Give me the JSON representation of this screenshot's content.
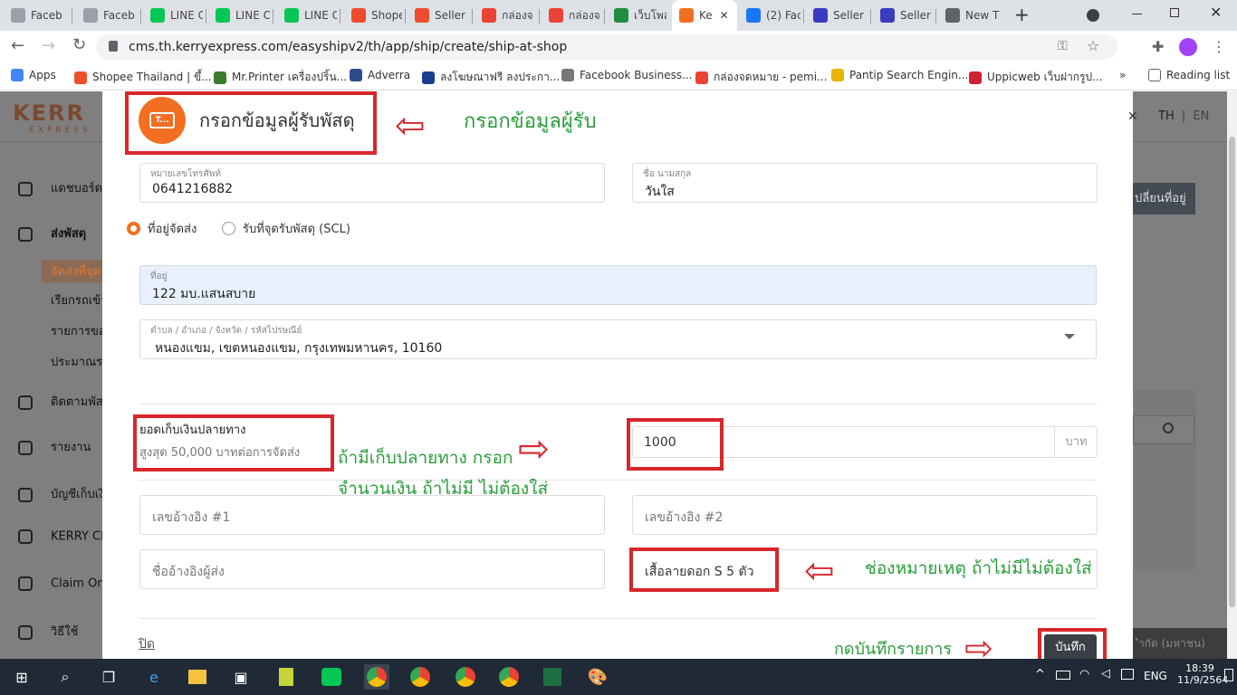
{
  "browser": {
    "tabs": [
      {
        "label": "Faceb",
        "icon": "facebook-icon",
        "color": "#9aa0a6"
      },
      {
        "label": "Faceb",
        "icon": "facebook-icon",
        "color": "#9aa0a6"
      },
      {
        "label": "LINE C",
        "icon": "line-icon",
        "color": "#06c755"
      },
      {
        "label": "LINE C",
        "icon": "line-icon",
        "color": "#06c755"
      },
      {
        "label": "LINE C",
        "icon": "line-icon",
        "color": "#06c755"
      },
      {
        "label": "Shope",
        "icon": "shopee-icon",
        "color": "#ee4d2d"
      },
      {
        "label": "Seller",
        "icon": "shopee-icon",
        "color": "#ee4d2d"
      },
      {
        "label": "กล่องจ",
        "icon": "gmail-icon",
        "color": "#ea4335"
      },
      {
        "label": "กล่องจ",
        "icon": "gmail-icon",
        "color": "#ea4335"
      },
      {
        "label": "เว็บโพส",
        "icon": "sheets-icon",
        "color": "#1e8e3e"
      },
      {
        "label": "Ke",
        "icon": "kerry-icon",
        "color": "#f26f21"
      },
      {
        "label": "(2) Fac",
        "icon": "facebook-icon",
        "color": "#1877f2"
      },
      {
        "label": "Seller",
        "icon": "seller-icon",
        "color": "#3b3bbf"
      },
      {
        "label": "Seller",
        "icon": "seller-icon",
        "color": "#3b3bbf"
      },
      {
        "label": "New T",
        "icon": "chrome-icon",
        "color": "#5f6368"
      }
    ],
    "url": "cms.th.kerryexpress.com/easyshipv2/th/app/ship/create/ship-at-shop",
    "bookmarks": [
      {
        "label": "Apps",
        "color": "#4285f4"
      },
      {
        "label": "Shopee Thailand | ขึ้...",
        "color": "#ee4d2d"
      },
      {
        "label": "Mr.Printer เครื่องปริ้น...",
        "color": "#3a7d2a"
      },
      {
        "label": "Adverra",
        "color": "#2b4c8c"
      },
      {
        "label": "ลงโฆษณาฟรี ลงประกา...",
        "color": "#1a3d8f"
      },
      {
        "label": "Facebook Business...",
        "color": "#777"
      },
      {
        "label": "กล่องจดหมาย - pemi...",
        "color": "#ea4335"
      },
      {
        "label": "Pantip Search Engin...",
        "color": "#e8b500"
      },
      {
        "label": "Uppicweb เว็บฝากรูป...",
        "color": "#cc2233"
      }
    ],
    "reading_list": "Reading list",
    "more": "»"
  },
  "background": {
    "logo_top": "KERR",
    "logo_bottom": "EXPRESS",
    "lang_th": "TH",
    "lang_sep": "|",
    "lang_en": "EN",
    "change_address_btn": "ปลี่ยนที่อยู่",
    "right_note": "ำกัด (มหาชน)",
    "sidebar": [
      {
        "label": "แดชบอร์ด",
        "icon": "dashboard-icon"
      },
      {
        "label": "ส่งพัสดุ",
        "icon": "ship-icon"
      },
      {
        "label": "จัดส่งที่จุด",
        "icon": ""
      },
      {
        "label": "เรียกรถเข้า",
        "icon": ""
      },
      {
        "label": "รายการขอ",
        "icon": ""
      },
      {
        "label": "ประมาณรา",
        "icon": ""
      },
      {
        "label": "ติดตามพัส",
        "icon": "track-icon"
      },
      {
        "label": "รายงาน",
        "icon": "report-icon"
      },
      {
        "label": "บัญชีเก็บเงิ",
        "icon": "account-icon"
      },
      {
        "label": "KERRY CL",
        "icon": "club-icon"
      },
      {
        "label": "Claim Onl",
        "icon": "claim-icon"
      },
      {
        "label": "วิธีใช้",
        "icon": "help-icon"
      }
    ]
  },
  "modal": {
    "header_icon_text": "T...",
    "title": "กรอกข้อมูลผู้รับพัสดุ",
    "phone": {
      "label": "หมายเลขโทรศัพท์",
      "value": "0641216882"
    },
    "name": {
      "label": "ชื่อ นามสกุล",
      "value": "วันใส"
    },
    "delivery_options": [
      {
        "label": "ที่อยู่จัดส่ง",
        "selected": true
      },
      {
        "label": "รับที่จุดรับพัสดุ (SCL)",
        "selected": false
      }
    ],
    "address": {
      "label": "ที่อยู่",
      "value": "122 มบ.แสนสบาย"
    },
    "district": {
      "label": "ตำบล / อำเภอ / จังหวัด / รหัสไปรษณีย์",
      "value": "หนองแขม, เขตหนองแขม, กรุงเทพมหานคร, 10160"
    },
    "cod": {
      "title": "ยอดเก็บเงินปลายทาง",
      "subtitle": "สูงสุด 50,000 บาทต่อการจัดส่ง",
      "value": "1000",
      "unit": "บาท"
    },
    "ref1_placeholder": "เลขอ้างอิง #1",
    "ref2_placeholder": "เลขอ้างอิง #2",
    "sender_ref_placeholder": "ชื่ออ้างอิงผู้ส่ง",
    "remark_value": "เสื้อลายดอก S 5 ตัว",
    "close_link": "ปิด",
    "save_button": "บันทึก"
  },
  "annotations": {
    "fill_receiver": "กรอกข้อมูลผู้รับ",
    "cod_line1": "ถ้ามีเก็บปลายทาง กรอก",
    "cod_line2": "จำนวนเงิน ถ้าไม่มี ไม่ต้องใส่",
    "remark_note": "ช่องหมายเหตุ ถ้าไม่มีไม่ต้องใส่",
    "save_note": "กดบันทึกรายการ",
    "color": "#2a9d3a",
    "highlight_color": "#d9262b"
  },
  "taskbar": {
    "time": "18:39",
    "date": "11/9/2564",
    "lang": "ENG"
  }
}
